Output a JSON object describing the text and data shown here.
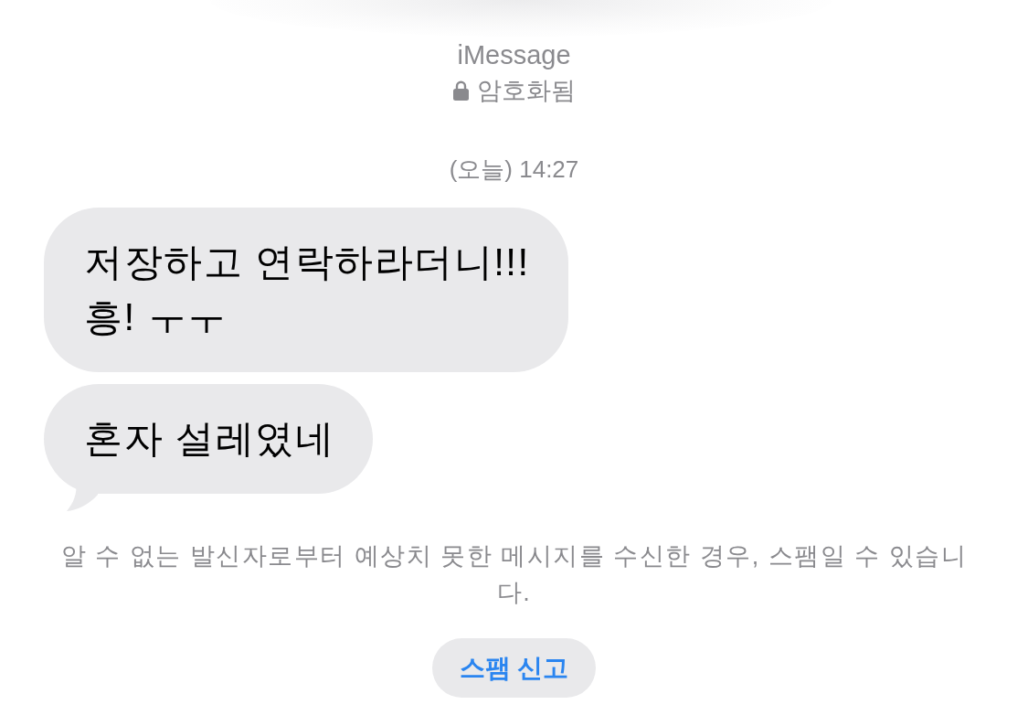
{
  "header": {
    "service": "iMessage",
    "encryption_label": "암호화됨"
  },
  "timestamp": "(오늘) 14:27",
  "messages": [
    {
      "text": "저장하고 연락하라더니!!!\n흥! ㅜㅜ",
      "tail": false
    },
    {
      "text": "혼자 설레였네",
      "tail": true
    }
  ],
  "notice": "알 수 없는 발신자로부터 예상치 못한 메시지를 수신한 경우, 스팸일 수 있습니다.",
  "report_button": {
    "label": "스팸 신고"
  }
}
